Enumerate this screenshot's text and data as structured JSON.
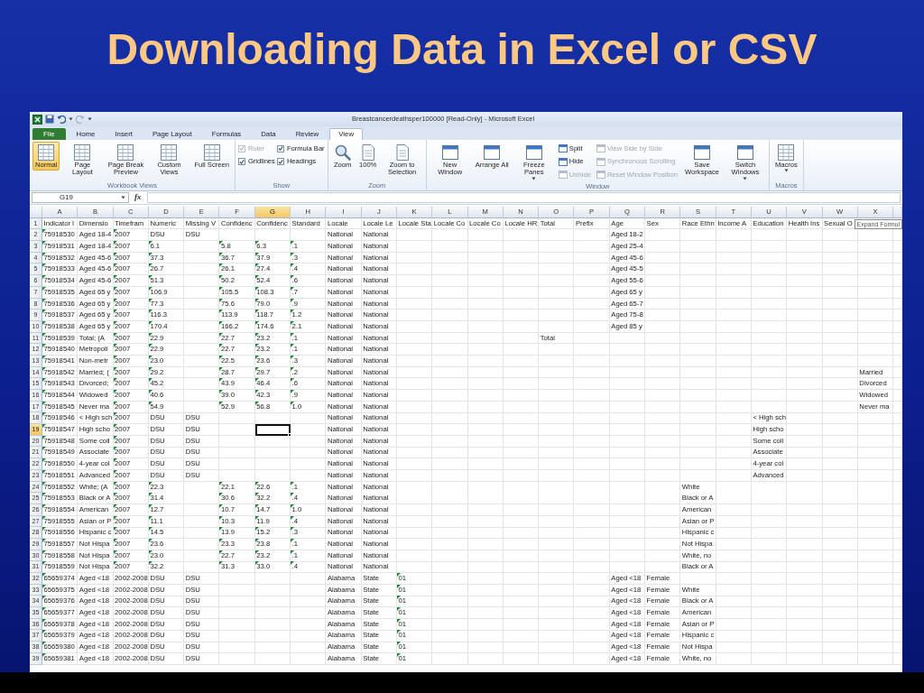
{
  "slide_title": "Downloading Data in Excel or CSV",
  "window": {
    "title": "Breastcancerdeathsper100000  [Read-Only]  -  Microsoft Excel"
  },
  "tabs": [
    {
      "label": "File",
      "kind": "file",
      "selected": false
    },
    {
      "label": "Home",
      "kind": "tab",
      "selected": false
    },
    {
      "label": "Insert",
      "kind": "tab",
      "selected": false
    },
    {
      "label": "Page Layout",
      "kind": "tab",
      "selected": false
    },
    {
      "label": "Formulas",
      "kind": "tab",
      "selected": false
    },
    {
      "label": "Data",
      "kind": "tab",
      "selected": false
    },
    {
      "label": "Review",
      "kind": "tab",
      "selected": false
    },
    {
      "label": "View",
      "kind": "tab",
      "selected": true
    }
  ],
  "ribbon": [
    {
      "label": "Workbook Views",
      "items": [
        {
          "kind": "large",
          "label": "Normal",
          "selected": true
        },
        {
          "kind": "large",
          "label": "Page Layout",
          "selected": false
        },
        {
          "kind": "large",
          "label": "Page Break Preview",
          "selected": false
        },
        {
          "kind": "large",
          "label": "Custom Views",
          "selected": false
        },
        {
          "kind": "large",
          "label": "Full Screen",
          "selected": false
        }
      ]
    },
    {
      "label": "Show",
      "items": [
        {
          "kind": "stack",
          "items": [
            {
              "kind": "checkbox",
              "label": "Ruler",
              "checked": true,
              "disabled": true
            },
            {
              "kind": "checkbox",
              "label": "Gridlines",
              "checked": true,
              "disabled": false
            }
          ]
        },
        {
          "kind": "stack",
          "items": [
            {
              "kind": "checkbox",
              "label": "Formula Bar",
              "checked": true,
              "disabled": false
            },
            {
              "kind": "checkbox",
              "label": "Headings",
              "checked": true,
              "disabled": false
            }
          ]
        }
      ]
    },
    {
      "label": "Zoom",
      "items": [
        {
          "kind": "large",
          "label": "Zoom"
        },
        {
          "kind": "large",
          "label": "100%"
        },
        {
          "kind": "large",
          "label": "Zoom to Selection"
        }
      ]
    },
    {
      "label": "Window",
      "items": [
        {
          "kind": "large",
          "label": "New Window"
        },
        {
          "kind": "large",
          "label": "Arrange All"
        },
        {
          "kind": "large",
          "label": "Freeze Panes",
          "menu": true
        },
        {
          "kind": "stack",
          "items": [
            {
              "kind": "small",
              "label": "Split",
              "disabled": false
            },
            {
              "kind": "small",
              "label": "Hide",
              "disabled": false
            },
            {
              "kind": "small",
              "label": "Unhide",
              "disabled": true
            }
          ]
        },
        {
          "kind": "stack",
          "items": [
            {
              "kind": "small",
              "label": "View Side by Side",
              "disabled": true
            },
            {
              "kind": "small",
              "label": "Synchronous Scrolling",
              "disabled": true
            },
            {
              "kind": "small",
              "label": "Reset Window Position",
              "disabled": true
            }
          ]
        },
        {
          "kind": "large",
          "label": "Save Workspace"
        },
        {
          "kind": "large",
          "label": "Switch Windows",
          "menu": true
        }
      ]
    },
    {
      "label": "Macros",
      "items": [
        {
          "kind": "large",
          "label": "Macros",
          "menu": true
        }
      ]
    }
  ],
  "formula_bar": {
    "name_box": "G19",
    "function_label": "fx"
  },
  "sheet": {
    "columns": [
      {
        "letter": "A",
        "selected": false
      },
      {
        "letter": "B",
        "selected": false
      },
      {
        "letter": "C",
        "selected": false
      },
      {
        "letter": "D",
        "selected": false
      },
      {
        "letter": "E",
        "selected": false
      },
      {
        "letter": "F",
        "selected": false
      },
      {
        "letter": "G",
        "selected": true
      },
      {
        "letter": "H",
        "selected": false
      },
      {
        "letter": "I",
        "selected": false
      },
      {
        "letter": "J",
        "selected": false
      },
      {
        "letter": "K",
        "selected": false
      },
      {
        "letter": "L",
        "selected": false
      },
      {
        "letter": "M",
        "selected": false
      },
      {
        "letter": "N",
        "selected": false
      },
      {
        "letter": "O",
        "selected": false
      },
      {
        "letter": "P",
        "selected": false
      },
      {
        "letter": "Q",
        "selected": false
      },
      {
        "letter": "R",
        "selected": false
      },
      {
        "letter": "S",
        "selected": false
      },
      {
        "letter": "T",
        "selected": false
      },
      {
        "letter": "U",
        "selected": false
      },
      {
        "letter": "V",
        "selected": false
      },
      {
        "letter": "W",
        "selected": false
      },
      {
        "letter": "X",
        "selected": false
      }
    ],
    "tooltip": "Expand Formul",
    "rows": [
      {
        "number": "1",
        "selected": false,
        "cells": {
          "A": "Indicator I",
          "B": "Dimensio",
          "C": "Timefram",
          "D": "Numeric",
          "E": "Missing V",
          "F": "Confidenc",
          "G": "Confidenc",
          "H": "Standard",
          "I": "Locale",
          "J": "Locale Le",
          "K": "Locale Sta",
          "L": "Locale Co",
          "M": "Locale Co",
          "N": "Locale HR",
          "O": "Total",
          "P": "Prefix",
          "Q": "Age",
          "R": "Sex",
          "S": "Race Ethn",
          "T": "Income A",
          "U": "Education",
          "V": "Health Ins",
          "W": "Sexual O"
        }
      },
      {
        "number": "2",
        "selected": false,
        "cells": {
          "A": {
            "text": "75918530",
            "flagged": true
          },
          "B": "Aged 18-4",
          "C": {
            "text": "2007",
            "flagged": true
          },
          "D": "DSU",
          "E": "DSU",
          "I": "National",
          "J": "National",
          "Q": "Aged 18-2"
        }
      },
      {
        "number": "3",
        "selected": false,
        "cells": {
          "A": {
            "text": "75918531",
            "flagged": true
          },
          "B": "Aged 18-4",
          "C": {
            "text": "2007",
            "flagged": true
          },
          "D": {
            "text": "6.1",
            "flagged": true
          },
          "F": {
            "text": "5.8",
            "flagged": true
          },
          "G": {
            "text": "6.3",
            "flagged": true
          },
          "H": {
            "text": ".1",
            "flagged": true
          },
          "I": "National",
          "J": "National",
          "Q": "Aged 25-4"
        }
      },
      {
        "number": "4",
        "selected": false,
        "cells": {
          "A": {
            "text": "75918532",
            "flagged": true
          },
          "B": "Aged 45-6",
          "C": {
            "text": "2007",
            "flagged": true
          },
          "D": {
            "text": "37.3",
            "flagged": true
          },
          "F": {
            "text": "36.7",
            "flagged": true
          },
          "G": {
            "text": "37.9",
            "flagged": true
          },
          "H": {
            "text": ".3",
            "flagged": true
          },
          "I": "National",
          "J": "National",
          "Q": "Aged 45-6"
        }
      },
      {
        "number": "5",
        "selected": false,
        "cells": {
          "A": {
            "text": "75918533",
            "flagged": true
          },
          "B": "Aged 45-6",
          "C": {
            "text": "2007",
            "flagged": true
          },
          "D": {
            "text": "26.7",
            "flagged": true
          },
          "F": {
            "text": "26.1",
            "flagged": true
          },
          "G": {
            "text": "27.4",
            "flagged": true
          },
          "H": {
            "text": ".4",
            "flagged": true
          },
          "I": "National",
          "J": "National",
          "Q": "Aged 45-5"
        }
      },
      {
        "number": "6",
        "selected": false,
        "cells": {
          "A": {
            "text": "75918534",
            "flagged": true
          },
          "B": "Aged 45-6",
          "C": {
            "text": "2007",
            "flagged": true
          },
          "D": {
            "text": "51.3",
            "flagged": true
          },
          "F": {
            "text": "50.2",
            "flagged": true
          },
          "G": {
            "text": "52.4",
            "flagged": true
          },
          "H": {
            "text": ".6",
            "flagged": true
          },
          "I": "National",
          "J": "National",
          "Q": "Aged 55-6"
        }
      },
      {
        "number": "7",
        "selected": false,
        "cells": {
          "A": {
            "text": "75918535",
            "flagged": true
          },
          "B": "Aged 65 y",
          "C": {
            "text": "2007",
            "flagged": true
          },
          "D": {
            "text": "106.9",
            "flagged": true
          },
          "F": {
            "text": "105.5",
            "flagged": true
          },
          "G": {
            "text": "108.3",
            "flagged": true
          },
          "H": {
            "text": ".7",
            "flagged": true
          },
          "I": "National",
          "J": "National",
          "Q": "Aged 65 y"
        }
      },
      {
        "number": "8",
        "selected": false,
        "cells": {
          "A": {
            "text": "75918536",
            "flagged": true
          },
          "B": "Aged 65 y",
          "C": {
            "text": "2007",
            "flagged": true
          },
          "D": {
            "text": "77.3",
            "flagged": true
          },
          "F": {
            "text": "75.6",
            "flagged": true
          },
          "G": {
            "text": "79.0",
            "flagged": true
          },
          "H": {
            "text": ".9",
            "flagged": true
          },
          "I": "National",
          "J": "National",
          "Q": "Aged 65-7"
        }
      },
      {
        "number": "9",
        "selected": false,
        "cells": {
          "A": {
            "text": "75918537",
            "flagged": true
          },
          "B": "Aged 65 y",
          "C": {
            "text": "2007",
            "flagged": true
          },
          "D": {
            "text": "116.3",
            "flagged": true
          },
          "F": {
            "text": "113.9",
            "flagged": true
          },
          "G": {
            "text": "118.7",
            "flagged": true
          },
          "H": {
            "text": "1.2",
            "flagged": true
          },
          "I": "National",
          "J": "National",
          "Q": "Aged 75-8"
        }
      },
      {
        "number": "10",
        "selected": false,
        "cells": {
          "A": {
            "text": "75918538",
            "flagged": true
          },
          "B": "Aged 65 y",
          "C": {
            "text": "2007",
            "flagged": true
          },
          "D": {
            "text": "170.4",
            "flagged": true
          },
          "F": {
            "text": "166.2",
            "flagged": true
          },
          "G": {
            "text": "174.6",
            "flagged": true
          },
          "H": {
            "text": "2.1",
            "flagged": true
          },
          "I": "National",
          "J": "National",
          "Q": "Aged 85 y"
        }
      },
      {
        "number": "11",
        "selected": false,
        "cells": {
          "A": {
            "text": "75918539",
            "flagged": true
          },
          "B": "Total; (A",
          "C": {
            "text": "2007",
            "flagged": true
          },
          "D": {
            "text": "22.9",
            "flagged": true
          },
          "F": {
            "text": "22.7",
            "flagged": true
          },
          "G": {
            "text": "23.2",
            "flagged": true
          },
          "H": {
            "text": ".1",
            "flagged": true
          },
          "I": "National",
          "J": "National",
          "O": "Total"
        }
      },
      {
        "number": "12",
        "selected": false,
        "cells": {
          "A": {
            "text": "75918540",
            "flagged": true
          },
          "B": "Metropoli",
          "C": {
            "text": "2007",
            "flagged": true
          },
          "D": {
            "text": "22.9",
            "flagged": true
          },
          "F": {
            "text": "22.7",
            "flagged": true
          },
          "G": {
            "text": "23.2",
            "flagged": true
          },
          "H": {
            "text": ".1",
            "flagged": true
          },
          "I": "National",
          "J": "National"
        }
      },
      {
        "number": "13",
        "selected": false,
        "cells": {
          "A": {
            "text": "75918541",
            "flagged": true
          },
          "B": "Non-metr",
          "C": {
            "text": "2007",
            "flagged": true
          },
          "D": {
            "text": "23.0",
            "flagged": true
          },
          "F": {
            "text": "22.5",
            "flagged": true
          },
          "G": {
            "text": "23.6",
            "flagged": true
          },
          "H": {
            "text": ".3",
            "flagged": true
          },
          "I": "National",
          "J": "National"
        }
      },
      {
        "number": "14",
        "selected": false,
        "cells": {
          "A": {
            "text": "75918542",
            "flagged": true
          },
          "B": "Married; (",
          "C": {
            "text": "2007",
            "flagged": true
          },
          "D": {
            "text": "29.2",
            "flagged": true
          },
          "F": {
            "text": "28.7",
            "flagged": true
          },
          "G": {
            "text": "29.7",
            "flagged": true
          },
          "H": {
            "text": ".2",
            "flagged": true
          },
          "I": "National",
          "J": "National",
          "X": "Married"
        }
      },
      {
        "number": "15",
        "selected": false,
        "cells": {
          "A": {
            "text": "75918543",
            "flagged": true
          },
          "B": "Divorced;",
          "C": {
            "text": "2007",
            "flagged": true
          },
          "D": {
            "text": "45.2",
            "flagged": true
          },
          "F": {
            "text": "43.9",
            "flagged": true
          },
          "G": {
            "text": "46.4",
            "flagged": true
          },
          "H": {
            "text": ".6",
            "flagged": true
          },
          "I": "National",
          "J": "National",
          "X": "Divorced"
        }
      },
      {
        "number": "16",
        "selected": false,
        "cells": {
          "A": {
            "text": "75918544",
            "flagged": true
          },
          "B": "Widowed",
          "C": {
            "text": "2007",
            "flagged": true
          },
          "D": {
            "text": "40.6",
            "flagged": true
          },
          "F": {
            "text": "39.0",
            "flagged": true
          },
          "G": {
            "text": "42.3",
            "flagged": true
          },
          "H": {
            "text": ".9",
            "flagged": true
          },
          "I": "National",
          "J": "National",
          "X": "Widowed"
        }
      },
      {
        "number": "17",
        "selected": false,
        "cells": {
          "A": {
            "text": "75918545",
            "flagged": true
          },
          "B": "Never ma",
          "C": {
            "text": "2007",
            "flagged": true
          },
          "D": {
            "text": "54.9",
            "flagged": true
          },
          "F": {
            "text": "52.9",
            "flagged": true
          },
          "G": {
            "text": "56.8",
            "flagged": true
          },
          "H": {
            "text": "1.0",
            "flagged": true
          },
          "I": "National",
          "J": "National",
          "X": "Never ma"
        }
      },
      {
        "number": "18",
        "selected": false,
        "cells": {
          "A": {
            "text": "75918546",
            "flagged": true
          },
          "B": "< High sch",
          "C": {
            "text": "2007",
            "flagged": true
          },
          "D": "DSU",
          "E": "DSU",
          "I": "National",
          "J": "National",
          "U": "< High sch"
        }
      },
      {
        "number": "19",
        "selected": true,
        "cells": {
          "A": {
            "text": "75918547",
            "flagged": true
          },
          "B": "High scho",
          "C": {
            "text": "2007",
            "flagged": true
          },
          "D": "DSU",
          "E": "DSU",
          "I": "National",
          "J": "National",
          "U": "High scho"
        }
      },
      {
        "number": "20",
        "selected": false,
        "cells": {
          "A": {
            "text": "75918548",
            "flagged": true
          },
          "B": "Some coll",
          "C": {
            "text": "2007",
            "flagged": true
          },
          "D": "DSU",
          "E": "DSU",
          "I": "National",
          "J": "National",
          "U": "Some coll"
        }
      },
      {
        "number": "21",
        "selected": false,
        "cells": {
          "A": {
            "text": "75918549",
            "flagged": true
          },
          "B": "Associate",
          "C": {
            "text": "2007",
            "flagged": true
          },
          "D": "DSU",
          "E": "DSU",
          "I": "National",
          "J": "National",
          "U": "Associate"
        }
      },
      {
        "number": "22",
        "selected": false,
        "cells": {
          "A": {
            "text": "75918550",
            "flagged": true
          },
          "B": "4-year col",
          "C": {
            "text": "2007",
            "flagged": true
          },
          "D": "DSU",
          "E": "DSU",
          "I": "National",
          "J": "National",
          "U": "4-year col"
        }
      },
      {
        "number": "23",
        "selected": false,
        "cells": {
          "A": {
            "text": "75918551",
            "flagged": true
          },
          "B": "Advanced",
          "C": {
            "text": "2007",
            "flagged": true
          },
          "D": "DSU",
          "E": "DSU",
          "I": "National",
          "J": "National",
          "U": "Advanced"
        }
      },
      {
        "number": "24",
        "selected": false,
        "cells": {
          "A": {
            "text": "75918552",
            "flagged": true
          },
          "B": "White; (A",
          "C": {
            "text": "2007",
            "flagged": true
          },
          "D": {
            "text": "22.3",
            "flagged": true
          },
          "F": {
            "text": "22.1",
            "flagged": true
          },
          "G": {
            "text": "22.6",
            "flagged": true
          },
          "H": {
            "text": ".1",
            "flagged": true
          },
          "I": "National",
          "J": "National",
          "S": "White"
        }
      },
      {
        "number": "25",
        "selected": false,
        "cells": {
          "A": {
            "text": "75918553",
            "flagged": true
          },
          "B": "Black or A",
          "C": {
            "text": "2007",
            "flagged": true
          },
          "D": {
            "text": "31.4",
            "flagged": true
          },
          "F": {
            "text": "30.6",
            "flagged": true
          },
          "G": {
            "text": "32.2",
            "flagged": true
          },
          "H": {
            "text": ".4",
            "flagged": true
          },
          "I": "National",
          "J": "National",
          "S": "Black or A"
        }
      },
      {
        "number": "26",
        "selected": false,
        "cells": {
          "A": {
            "text": "75918554",
            "flagged": true
          },
          "B": "American",
          "C": {
            "text": "2007",
            "flagged": true
          },
          "D": {
            "text": "12.7",
            "flagged": true
          },
          "F": {
            "text": "10.7",
            "flagged": true
          },
          "G": {
            "text": "14.7",
            "flagged": true
          },
          "H": {
            "text": "1.0",
            "flagged": true
          },
          "I": "National",
          "J": "National",
          "S": "American"
        }
      },
      {
        "number": "27",
        "selected": false,
        "cells": {
          "A": {
            "text": "75918555",
            "flagged": true
          },
          "B": "Asian or P",
          "C": {
            "text": "2007",
            "flagged": true
          },
          "D": {
            "text": "11.1",
            "flagged": true
          },
          "F": {
            "text": "10.3",
            "flagged": true
          },
          "G": {
            "text": "11.9",
            "flagged": true
          },
          "H": {
            "text": ".4",
            "flagged": true
          },
          "I": "National",
          "J": "National",
          "S": "Asian or P"
        }
      },
      {
        "number": "28",
        "selected": false,
        "cells": {
          "A": {
            "text": "75918556",
            "flagged": true
          },
          "B": "Hispanic c",
          "C": {
            "text": "2007",
            "flagged": true
          },
          "D": {
            "text": "14.5",
            "flagged": true
          },
          "F": {
            "text": "13.9",
            "flagged": true
          },
          "G": {
            "text": "15.2",
            "flagged": true
          },
          "H": {
            "text": ".3",
            "flagged": true
          },
          "I": "National",
          "J": "National",
          "S": "Hispanic c"
        }
      },
      {
        "number": "29",
        "selected": false,
        "cells": {
          "A": {
            "text": "75918557",
            "flagged": true
          },
          "B": "Not Hispa",
          "C": {
            "text": "2007",
            "flagged": true
          },
          "D": {
            "text": "23.6",
            "flagged": true
          },
          "F": {
            "text": "23.3",
            "flagged": true
          },
          "G": {
            "text": "23.8",
            "flagged": true
          },
          "H": {
            "text": ".1",
            "flagged": true
          },
          "I": "National",
          "J": "National",
          "S": "Not Hispa"
        }
      },
      {
        "number": "30",
        "selected": false,
        "cells": {
          "A": {
            "text": "75918558",
            "flagged": true
          },
          "B": "Not Hispa",
          "C": {
            "text": "2007",
            "flagged": true
          },
          "D": {
            "text": "23.0",
            "flagged": true
          },
          "F": {
            "text": "22.7",
            "flagged": true
          },
          "G": {
            "text": "23.2",
            "flagged": true
          },
          "H": {
            "text": ".1",
            "flagged": true
          },
          "I": "National",
          "J": "National",
          "S": "White, no"
        }
      },
      {
        "number": "31",
        "selected": false,
        "cells": {
          "A": {
            "text": "75918559",
            "flagged": true
          },
          "B": "Not Hispa",
          "C": {
            "text": "2007",
            "flagged": true
          },
          "D": {
            "text": "32.2",
            "flagged": true
          },
          "F": {
            "text": "31.3",
            "flagged": true
          },
          "G": {
            "text": "33.0",
            "flagged": true
          },
          "H": {
            "text": ".4",
            "flagged": true
          },
          "I": "National",
          "J": "National",
          "S": "Black or A"
        }
      },
      {
        "number": "32",
        "selected": false,
        "cells": {
          "A": {
            "text": "65659374",
            "flagged": true
          },
          "B": "Aged <18",
          "C": "2002-2008",
          "D": "DSU",
          "E": "DSU",
          "I": "Alabama",
          "J": "State",
          "K": {
            "text": "01",
            "flagged": true
          },
          "Q": "Aged <18",
          "R": "Female"
        }
      },
      {
        "number": "33",
        "selected": false,
        "cells": {
          "A": {
            "text": "65659375",
            "flagged": true
          },
          "B": "Aged <18",
          "C": "2002-2008",
          "D": "DSU",
          "E": "DSU",
          "I": "Alabama",
          "J": "State",
          "K": {
            "text": "01",
            "flagged": true
          },
          "Q": "Aged <18",
          "R": "Female",
          "S": "White"
        }
      },
      {
        "number": "34",
        "selected": false,
        "cells": {
          "A": {
            "text": "65659376",
            "flagged": true
          },
          "B": "Aged <18",
          "C": "2002-2008",
          "D": "DSU",
          "E": "DSU",
          "I": "Alabama",
          "J": "State",
          "K": {
            "text": "01",
            "flagged": true
          },
          "Q": "Aged <18",
          "R": "Female",
          "S": "Black or A"
        }
      },
      {
        "number": "35",
        "selected": false,
        "cells": {
          "A": {
            "text": "65659377",
            "flagged": true
          },
          "B": "Aged <18",
          "C": "2002-2008",
          "D": "DSU",
          "E": "DSU",
          "I": "Alabama",
          "J": "State",
          "K": {
            "text": "01",
            "flagged": true
          },
          "Q": "Aged <18",
          "R": "Female",
          "S": "American"
        }
      },
      {
        "number": "36",
        "selected": false,
        "cells": {
          "A": {
            "text": "65659378",
            "flagged": true
          },
          "B": "Aged <18",
          "C": "2002-2008",
          "D": "DSU",
          "E": "DSU",
          "I": "Alabama",
          "J": "State",
          "K": {
            "text": "01",
            "flagged": true
          },
          "Q": "Aged <18",
          "R": "Female",
          "S": "Asian or P"
        }
      },
      {
        "number": "37",
        "selected": false,
        "cells": {
          "A": {
            "text": "65659379",
            "flagged": true
          },
          "B": "Aged <18",
          "C": "2002-2008",
          "D": "DSU",
          "E": "DSU",
          "I": "Alabama",
          "J": "State",
          "K": {
            "text": "01",
            "flagged": true
          },
          "Q": "Aged <18",
          "R": "Female",
          "S": "Hispanic c"
        }
      },
      {
        "number": "38",
        "selected": false,
        "cells": {
          "A": {
            "text": "65659380",
            "flagged": true
          },
          "B": "Aged <18",
          "C": "2002-2008",
          "D": "DSU",
          "E": "DSU",
          "I": "Alabama",
          "J": "State",
          "K": {
            "text": "01",
            "flagged": true
          },
          "Q": "Aged <18",
          "R": "Female",
          "S": "Not Hispa"
        }
      },
      {
        "number": "39",
        "selected": false,
        "cells": {
          "A": {
            "text": "65659381",
            "flagged": true
          },
          "B": "Aged <18",
          "C": "2002-2008",
          "D": "DSU",
          "E": "DSU",
          "I": "Alabama",
          "J": "State",
          "K": {
            "text": "01",
            "flagged": true
          },
          "Q": "Aged <18",
          "R": "Female",
          "S": "White, no"
        }
      }
    ]
  }
}
